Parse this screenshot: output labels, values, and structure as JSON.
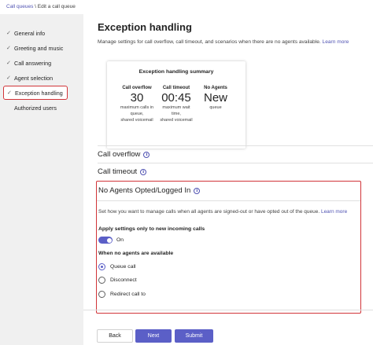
{
  "breadcrumb": {
    "parent": "Call queues",
    "separator": "\\",
    "current": "Edit a call queue"
  },
  "sidebar": {
    "items": [
      {
        "label": "General info",
        "checked": true
      },
      {
        "label": "Greeting and music",
        "checked": true
      },
      {
        "label": "Call answering",
        "checked": true
      },
      {
        "label": "Agent selection",
        "checked": true
      },
      {
        "label": "Exception handling",
        "checked": true,
        "selected": true
      },
      {
        "label": "Authorized users",
        "checked": false
      }
    ]
  },
  "main": {
    "title": "Exception handling",
    "description": "Manage settings for call overflow, call timeout, and scenarios when there are no agents available.",
    "learn_more": "Learn more"
  },
  "summary": {
    "title": "Exception handling summary",
    "columns": [
      {
        "head": "Call overflow",
        "value": "30",
        "sub1": "maximum calls in",
        "sub2": "queue,",
        "sub3": "shared voicemail"
      },
      {
        "head": "Call timeout",
        "value": "00:45",
        "sub1": "maximum wait",
        "sub2": "time,",
        "sub3": "shared voicemail"
      },
      {
        "head": "No Agents",
        "value": "New",
        "sub1": "queue",
        "sub2": "",
        "sub3": ""
      }
    ]
  },
  "sections": {
    "call_overflow": "Call overflow",
    "call_timeout": "Call timeout",
    "no_agents": "No Agents Opted/Logged In"
  },
  "no_agents": {
    "description": "Set how you want to manage calls when all agents are signed-out or have opted out of the queue.",
    "learn_more": "Learn more",
    "apply_label": "Apply settings only to new incoming calls",
    "toggle_label": "On",
    "toggle_on": true,
    "when_label": "When no agents are available",
    "options": [
      {
        "label": "Queue call",
        "checked": true
      },
      {
        "label": "Disconnect",
        "checked": false
      },
      {
        "label": "Redirect call to",
        "checked": false
      }
    ]
  },
  "footer": {
    "back": "Back",
    "next": "Next",
    "submit": "Submit"
  },
  "colors": {
    "accent": "#5b5fc7",
    "highlight": "#d13438",
    "link": "#4f52b2"
  },
  "icons": {
    "check": "check-icon",
    "info": "info-icon"
  }
}
